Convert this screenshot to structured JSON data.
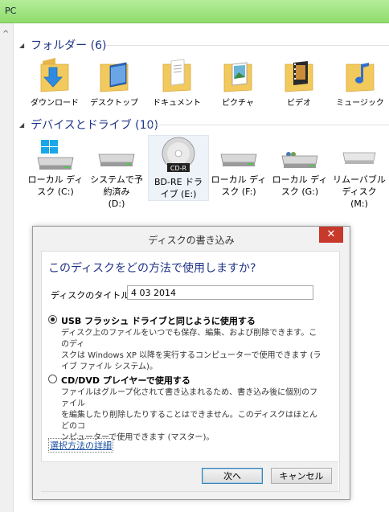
{
  "window": {
    "title": "PC"
  },
  "groups": {
    "folders": {
      "label": "フォルダー (6)"
    },
    "devices": {
      "label": "デバイスとドライブ (10)"
    }
  },
  "folders": [
    {
      "label": "ダウンロード",
      "icon": "downloads-folder-icon"
    },
    {
      "label": "デスクトップ",
      "icon": "desktop-folder-icon"
    },
    {
      "label": "ドキュメント",
      "icon": "documents-folder-icon"
    },
    {
      "label": "ピクチャ",
      "icon": "pictures-folder-icon"
    },
    {
      "label": "ビデオ",
      "icon": "videos-folder-icon"
    },
    {
      "label": "ミュージック",
      "icon": "music-folder-icon"
    }
  ],
  "drives": [
    {
      "line1": "ローカル ディ",
      "line2": "スク (C:)",
      "line3": "",
      "icon": "windows-drive-icon"
    },
    {
      "line1": "システムで予",
      "line2": "約済み",
      "line3": "(D:)",
      "icon": "hard-drive-icon"
    },
    {
      "line1": "BD-RE ドラ",
      "line2": "イブ (E:)",
      "line3": "",
      "icon": "cd-r-disc-icon",
      "disc_label": "CD-R"
    },
    {
      "line1": "ローカル ディ",
      "line2": "スク (F:)",
      "line3": "",
      "icon": "hard-drive-icon"
    },
    {
      "line1": "ローカル ディ",
      "line2": "スク (G:)",
      "line3": "",
      "icon": "shared-drive-icon"
    },
    {
      "line1": "リムーバブル",
      "line2": "ディスク",
      "line3": "(M:)",
      "icon": "removable-drive-icon"
    }
  ],
  "dialog": {
    "title": "ディスクの書き込み",
    "close": "✕",
    "question": "このディスクをどの方法で使用しますか?",
    "disc_title_label": "ディスクのタイトル:",
    "disc_title_value": "4 03 2014",
    "option_usb": {
      "heading": "USB フラッシュ ドライブと同じように使用する",
      "desc1": "ディスク上のファイルをいつでも保存、編集、および削除できます。このディ",
      "desc2": "スクは Windows XP 以降を実行するコンピューターで使用できます (ラ",
      "desc3": "イブ ファイル システム)。",
      "selected": true
    },
    "option_cd": {
      "heading": "CD/DVD プレイヤーで使用する",
      "desc1": "ファイルはグループ化されて書き込まれるため、書き込み後に個別のファイル",
      "desc2": "を編集したり削除したりすることはできません。このディスクはほとんどのコ",
      "desc3": "ンピューターで使用できます (マスター)。",
      "selected": false
    },
    "details_link": "選択方法の詳細",
    "next_button": "次へ",
    "cancel_button": "キャンセル"
  },
  "colors": {
    "accent_blue": "#1e3287",
    "titlebar_green": "#8fdc6c",
    "close_red": "#c7392b",
    "folder_yellow": "#f2c95c"
  }
}
